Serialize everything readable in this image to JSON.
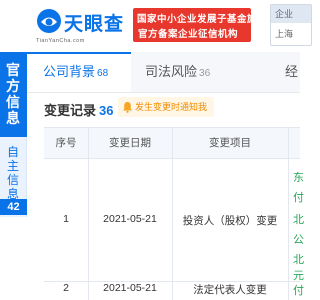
{
  "header": {
    "logo_cn": "天眼查",
    "logo_en": "TianYanCha.com",
    "banner_line1": "国家中小企业发展子基金旗下",
    "banner_line2": "官方备案企业征信机构",
    "region_top": "企业",
    "region_bottom": "上海"
  },
  "sidebar": {
    "official": "官方信息",
    "self": "自主信息",
    "self_count": "42"
  },
  "tabs": [
    {
      "label": "公司背景",
      "count": "68"
    },
    {
      "label": "司法风险",
      "count": "36"
    },
    {
      "label": "经",
      "count": ""
    }
  ],
  "section": {
    "title": "变更记录",
    "count": "36",
    "notify_label": "发生变更时通知我"
  },
  "table": {
    "headers": [
      "序号",
      "变更日期",
      "变更项目"
    ],
    "rows": [
      {
        "index": "1",
        "date": "2021-05-21",
        "item": "投资人（股权）变更",
        "extra": [
          "东",
          "付",
          "北",
          "公",
          "北",
          "元"
        ]
      },
      {
        "index": "2",
        "date": "2021-05-21",
        "item": "法定代表人变更",
        "extra": [
          "付"
        ]
      }
    ]
  },
  "colors": {
    "brand_blue": "#0a73e8",
    "banner_red": "#e8372c",
    "notify_orange": "#f08c00",
    "extra_green": "#2aa55a"
  }
}
